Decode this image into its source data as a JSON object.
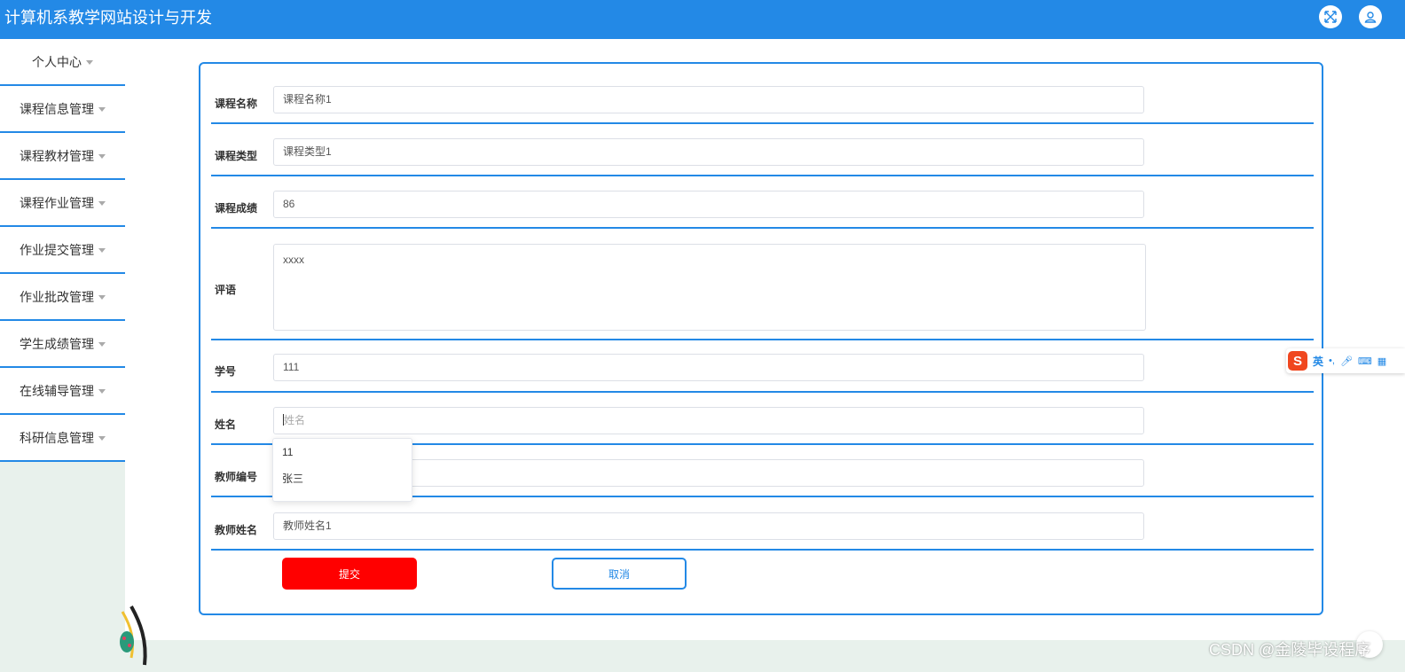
{
  "header": {
    "title": "计算机系教学网站设计与开发",
    "fullscreen_icon": "fullscreen-icon",
    "user_icon": "user-icon"
  },
  "sidebar": {
    "items": [
      {
        "label": "个人中心"
      },
      {
        "label": "课程信息管理"
      },
      {
        "label": "课程教材管理"
      },
      {
        "label": "课程作业管理"
      },
      {
        "label": "作业提交管理"
      },
      {
        "label": "作业批改管理"
      },
      {
        "label": "学生成绩管理"
      },
      {
        "label": "在线辅导管理"
      },
      {
        "label": "科研信息管理"
      }
    ]
  },
  "form": {
    "course_name": {
      "label": "课程名称",
      "value": "课程名称1"
    },
    "course_type": {
      "label": "课程类型",
      "value": "课程类型1"
    },
    "course_score": {
      "label": "课程成绩",
      "value": "86"
    },
    "comment": {
      "label": "评语",
      "value": "xxxx"
    },
    "student_id": {
      "label": "学号",
      "value": "111"
    },
    "student_name": {
      "label": "姓名",
      "value": "",
      "placeholder": "姓名"
    },
    "teacher_id": {
      "label": "教师编号",
      "value": ""
    },
    "teacher_name": {
      "label": "教师姓名",
      "value": "教师姓名1"
    },
    "submit_label": "提交",
    "cancel_label": "取消"
  },
  "name_dropdown": {
    "options": [
      "11",
      "张三"
    ]
  },
  "ime": {
    "logo": "S",
    "mode": "英"
  },
  "watermark": "CSDN @金陵毕设程序",
  "colors": {
    "primary": "#2389e6",
    "submit": "#ff0000",
    "page_bg": "#e8f1ec"
  }
}
